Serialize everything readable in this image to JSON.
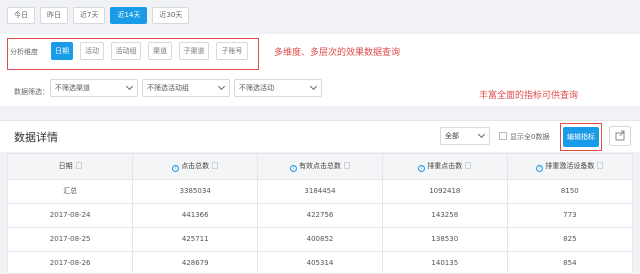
{
  "date_tabs": [
    {
      "label": "今日",
      "active": false
    },
    {
      "label": "昨日",
      "active": false
    },
    {
      "label": "近7天",
      "active": false
    },
    {
      "label": "近14天",
      "active": true
    },
    {
      "label": "近30天",
      "active": false
    }
  ],
  "dimension": {
    "label": "分析维度",
    "options": [
      {
        "label": "日期",
        "active": true
      },
      {
        "label": "活动",
        "active": false
      },
      {
        "label": "活动组",
        "active": false
      },
      {
        "label": "渠道",
        "active": false
      },
      {
        "label": "子渠道",
        "active": false
      },
      {
        "label": "子账号",
        "active": false
      }
    ]
  },
  "annotations": {
    "dimension_note": "多维度、多层次的效果数据查询",
    "metrics_note": "丰富全面的指标可供查询"
  },
  "filters": {
    "label": "数据筛选：",
    "selects": [
      "不筛选渠道",
      "不筛选活动组",
      "不筛选活动"
    ]
  },
  "detail": {
    "title": "数据详情",
    "scope": "全部",
    "show_zero_label": "显示全0数据",
    "edit_metrics_label": "编辑指标"
  },
  "table": {
    "columns": [
      "日期",
      "点击总数",
      "有效点击总数",
      "排重点击数",
      "排重激活设备数"
    ],
    "rows": [
      [
        "汇总",
        "3385034",
        "3184454",
        "1092418",
        "8150"
      ],
      [
        "2017-08-24",
        "441366",
        "422756",
        "143258",
        "773"
      ],
      [
        "2017-08-25",
        "425711",
        "400852",
        "138530",
        "825"
      ],
      [
        "2017-08-26",
        "428679",
        "405314",
        "140135",
        "854"
      ]
    ]
  }
}
